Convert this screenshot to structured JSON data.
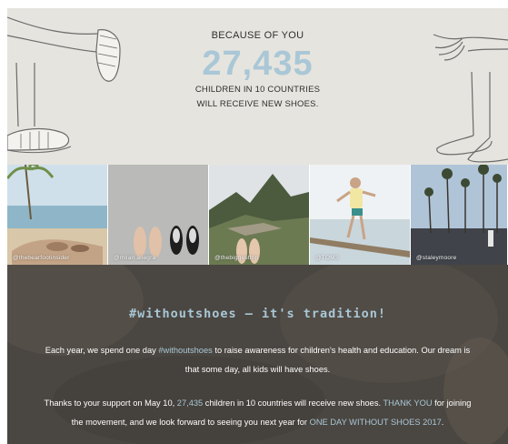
{
  "hero": {
    "top_line": "BECAUSE OF YOU",
    "count": "27,435",
    "line1": "CHILDREN IN 10 COUNTRIES",
    "line2": "WILL RECEIVE NEW SHOES."
  },
  "photos": [
    {
      "handle": "@thebearfootinsider"
    },
    {
      "handle": "@milan.allegra"
    },
    {
      "handle": "@thebiggesttrip"
    },
    {
      "handle": "@TOMS"
    },
    {
      "handle": "@staleymoore"
    }
  ],
  "bottom": {
    "heading": "#withoutshoes — it's tradition!",
    "p1": {
      "a": "Each year, we spend one day ",
      "tag": "#withoutshoes",
      "b": " to raise awareness for children's health and education. Our dream is",
      "c": "that some day, all kids will have shoes."
    },
    "p2": {
      "a": "Thanks to your support on May 10, ",
      "count": "27,435",
      "b": " children in 10 countries will receive new shoes. ",
      "thanks": "THANK YOU",
      "c": " for joining",
      "d": "the movement, and we look forward to seeing you next year for ",
      "event": "ONE DAY WITHOUT SHOES 2017",
      "e": "."
    }
  },
  "colors": {
    "accent": "#a9c7d6",
    "hero_bg": "#e6e4de",
    "bottom_bg": "#4a4641"
  }
}
